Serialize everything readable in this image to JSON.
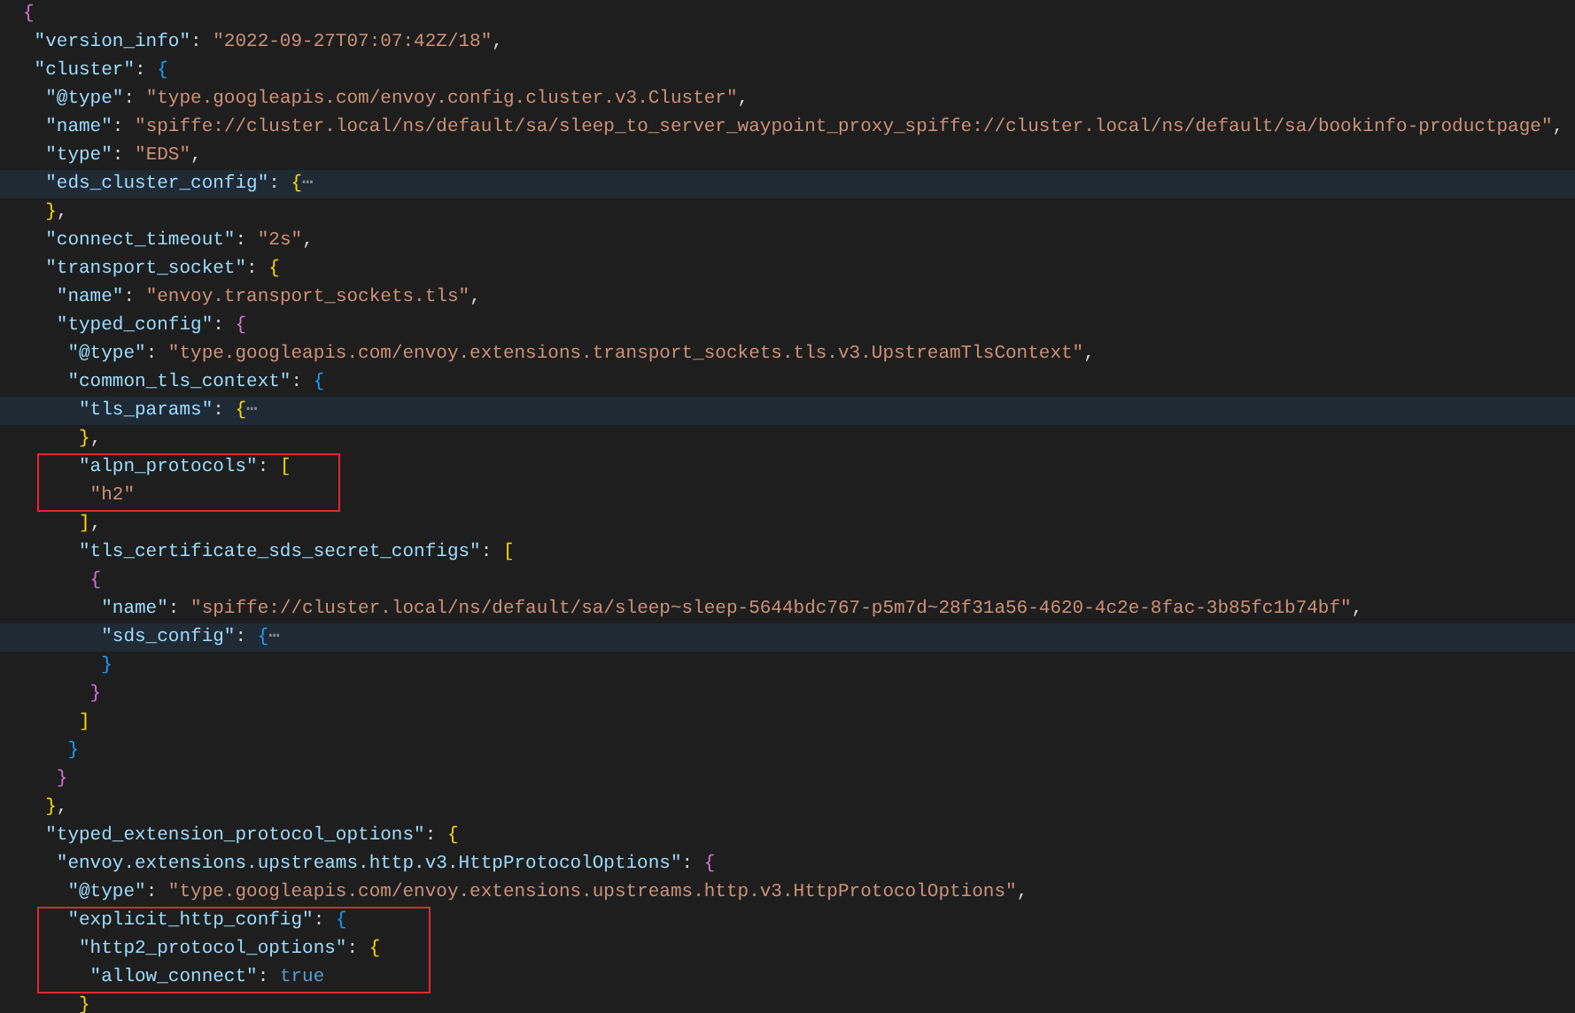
{
  "editor": {
    "blocks": [
      {
        "kind": "plain",
        "lines": [
          {
            "highlighted": false,
            "tokens": [
              {
                "kind": "bracket2",
                "text": "{"
              }
            ]
          },
          {
            "highlighted": false,
            "tokens": [
              {
                "kind": "key",
                "text": " \"version_info\""
              },
              {
                "kind": "punct",
                "text": ": "
              },
              {
                "kind": "string",
                "text": "\"2022-09-27T07:07:42Z/18\""
              },
              {
                "kind": "punct",
                "text": ","
              }
            ]
          },
          {
            "highlighted": false,
            "tokens": [
              {
                "kind": "key",
                "text": " \"cluster\""
              },
              {
                "kind": "punct",
                "text": ": "
              },
              {
                "kind": "bracket3",
                "text": "{"
              }
            ]
          },
          {
            "highlighted": false,
            "tokens": [
              {
                "kind": "key",
                "text": "  \"@type\""
              },
              {
                "kind": "punct",
                "text": ": "
              },
              {
                "kind": "string",
                "text": "\"type.googleapis.com/envoy.config.cluster.v3.Cluster\""
              },
              {
                "kind": "punct",
                "text": ","
              }
            ]
          },
          {
            "highlighted": false,
            "tokens": [
              {
                "kind": "key",
                "text": "  \"name\""
              },
              {
                "kind": "punct",
                "text": ": "
              },
              {
                "kind": "string",
                "text": "\"spiffe://cluster.local/ns/default/sa/sleep_to_server_waypoint_proxy_spiffe://cluster.local/ns/default/sa/bookinfo-productpage\""
              },
              {
                "kind": "punct",
                "text": ","
              }
            ]
          },
          {
            "highlighted": false,
            "tokens": [
              {
                "kind": "key",
                "text": "  \"type\""
              },
              {
                "kind": "punct",
                "text": ": "
              },
              {
                "kind": "string",
                "text": "\"EDS\""
              },
              {
                "kind": "punct",
                "text": ","
              }
            ]
          },
          {
            "highlighted": true,
            "tokens": [
              {
                "kind": "key",
                "text": "  \"eds_cluster_config\""
              },
              {
                "kind": "punct",
                "text": ": "
              },
              {
                "kind": "bracket1",
                "text": "{"
              },
              {
                "kind": "fold",
                "text": "⋯"
              }
            ]
          },
          {
            "highlighted": false,
            "tokens": [
              {
                "kind": "bracket1",
                "text": "  }"
              },
              {
                "kind": "punct",
                "text": ","
              }
            ]
          },
          {
            "highlighted": false,
            "tokens": [
              {
                "kind": "key",
                "text": "  \"connect_timeout\""
              },
              {
                "kind": "punct",
                "text": ": "
              },
              {
                "kind": "string",
                "text": "\"2s\""
              },
              {
                "kind": "punct",
                "text": ","
              }
            ]
          },
          {
            "highlighted": false,
            "tokens": [
              {
                "kind": "key",
                "text": "  \"transport_socket\""
              },
              {
                "kind": "punct",
                "text": ": "
              },
              {
                "kind": "bracket1",
                "text": "{"
              }
            ]
          },
          {
            "highlighted": false,
            "tokens": [
              {
                "kind": "key",
                "text": "   \"name\""
              },
              {
                "kind": "punct",
                "text": ": "
              },
              {
                "kind": "string",
                "text": "\"envoy.transport_sockets.tls\""
              },
              {
                "kind": "punct",
                "text": ","
              }
            ]
          },
          {
            "highlighted": false,
            "tokens": [
              {
                "kind": "key",
                "text": "   \"typed_config\""
              },
              {
                "kind": "punct",
                "text": ": "
              },
              {
                "kind": "bracket2",
                "text": "{"
              }
            ]
          },
          {
            "highlighted": false,
            "tokens": [
              {
                "kind": "key",
                "text": "    \"@type\""
              },
              {
                "kind": "punct",
                "text": ": "
              },
              {
                "kind": "string",
                "text": "\"type.googleapis.com/envoy.extensions.transport_sockets.tls.v3.UpstreamTlsContext\""
              },
              {
                "kind": "punct",
                "text": ","
              }
            ]
          },
          {
            "highlighted": false,
            "tokens": [
              {
                "kind": "key",
                "text": "    \"common_tls_context\""
              },
              {
                "kind": "punct",
                "text": ": "
              },
              {
                "kind": "bracket3",
                "text": "{"
              }
            ]
          },
          {
            "highlighted": true,
            "tokens": [
              {
                "kind": "key",
                "text": "     \"tls_params\""
              },
              {
                "kind": "punct",
                "text": ": "
              },
              {
                "kind": "bracket1",
                "text": "{"
              },
              {
                "kind": "fold",
                "text": "⋯"
              }
            ]
          },
          {
            "highlighted": false,
            "tokens": [
              {
                "kind": "bracket1",
                "text": "     }"
              },
              {
                "kind": "punct",
                "text": ","
              }
            ]
          }
        ]
      },
      {
        "kind": "boxed",
        "lines": [
          {
            "highlighted": false,
            "tokens": [
              {
                "kind": "key",
                "text": "     \"alpn_protocols\""
              },
              {
                "kind": "punct",
                "text": ": "
              },
              {
                "kind": "bracket1",
                "text": "["
              }
            ]
          },
          {
            "highlighted": false,
            "tokens": [
              {
                "kind": "string",
                "text": "      \"h2\""
              }
            ]
          }
        ]
      },
      {
        "kind": "plain",
        "lines": [
          {
            "highlighted": false,
            "tokens": [
              {
                "kind": "bracket1",
                "text": "     ]"
              },
              {
                "kind": "punct",
                "text": ","
              }
            ]
          },
          {
            "highlighted": false,
            "tokens": [
              {
                "kind": "key",
                "text": "     \"tls_certificate_sds_secret_configs\""
              },
              {
                "kind": "punct",
                "text": ": "
              },
              {
                "kind": "bracket1",
                "text": "["
              }
            ]
          },
          {
            "highlighted": false,
            "tokens": [
              {
                "kind": "bracket2",
                "text": "      {"
              }
            ]
          },
          {
            "highlighted": false,
            "tokens": [
              {
                "kind": "key",
                "text": "       \"name\""
              },
              {
                "kind": "punct",
                "text": ": "
              },
              {
                "kind": "string",
                "text": "\"spiffe://cluster.local/ns/default/sa/sleep~sleep-5644bdc767-p5m7d~28f31a56-4620-4c2e-8fac-3b85fc1b74bf\""
              },
              {
                "kind": "punct",
                "text": ","
              }
            ]
          },
          {
            "highlighted": true,
            "tokens": [
              {
                "kind": "key",
                "text": "       \"sds_config\""
              },
              {
                "kind": "punct",
                "text": ": "
              },
              {
                "kind": "bracket3",
                "text": "{"
              },
              {
                "kind": "fold",
                "text": "⋯"
              }
            ]
          },
          {
            "highlighted": false,
            "tokens": [
              {
                "kind": "bracket3",
                "text": "       }"
              }
            ]
          },
          {
            "highlighted": false,
            "tokens": [
              {
                "kind": "bracket2",
                "text": "      }"
              }
            ]
          },
          {
            "highlighted": false,
            "tokens": [
              {
                "kind": "bracket1",
                "text": "     ]"
              }
            ]
          },
          {
            "highlighted": false,
            "tokens": [
              {
                "kind": "bracket3",
                "text": "    }"
              }
            ]
          },
          {
            "highlighted": false,
            "tokens": [
              {
                "kind": "bracket2",
                "text": "   }"
              }
            ]
          },
          {
            "highlighted": false,
            "tokens": [
              {
                "kind": "bracket1",
                "text": "  }"
              },
              {
                "kind": "punct",
                "text": ","
              }
            ]
          },
          {
            "highlighted": false,
            "tokens": [
              {
                "kind": "key",
                "text": "  \"typed_extension_protocol_options\""
              },
              {
                "kind": "punct",
                "text": ": "
              },
              {
                "kind": "bracket1",
                "text": "{"
              }
            ]
          },
          {
            "highlighted": false,
            "tokens": [
              {
                "kind": "key",
                "text": "   \"envoy.extensions.upstreams.http.v3.HttpProtocolOptions\""
              },
              {
                "kind": "punct",
                "text": ": "
              },
              {
                "kind": "bracket2",
                "text": "{"
              }
            ]
          },
          {
            "highlighted": false,
            "tokens": [
              {
                "kind": "key",
                "text": "    \"@type\""
              },
              {
                "kind": "punct",
                "text": ": "
              },
              {
                "kind": "string",
                "text": "\"type.googleapis.com/envoy.extensions.upstreams.http.v3.HttpProtocolOptions\""
              },
              {
                "kind": "punct",
                "text": ","
              }
            ]
          }
        ]
      },
      {
        "kind": "boxed",
        "lines": [
          {
            "highlighted": false,
            "tokens": [
              {
                "kind": "key",
                "text": "    \"explicit_http_config\""
              },
              {
                "kind": "punct",
                "text": ": "
              },
              {
                "kind": "bracket3",
                "text": "{"
              }
            ]
          },
          {
            "highlighted": false,
            "tokens": [
              {
                "kind": "key",
                "text": "     \"http2_protocol_options\""
              },
              {
                "kind": "punct",
                "text": ": "
              },
              {
                "kind": "bracket1",
                "text": "{"
              }
            ]
          },
          {
            "highlighted": false,
            "tokens": [
              {
                "kind": "key",
                "text": "      \"allow_connect\""
              },
              {
                "kind": "punct",
                "text": ": "
              },
              {
                "kind": "keyword",
                "text": "true"
              }
            ]
          }
        ]
      },
      {
        "kind": "plain",
        "lines": [
          {
            "highlighted": false,
            "tokens": [
              {
                "kind": "bracket1",
                "text": "     }"
              }
            ]
          }
        ]
      }
    ]
  }
}
